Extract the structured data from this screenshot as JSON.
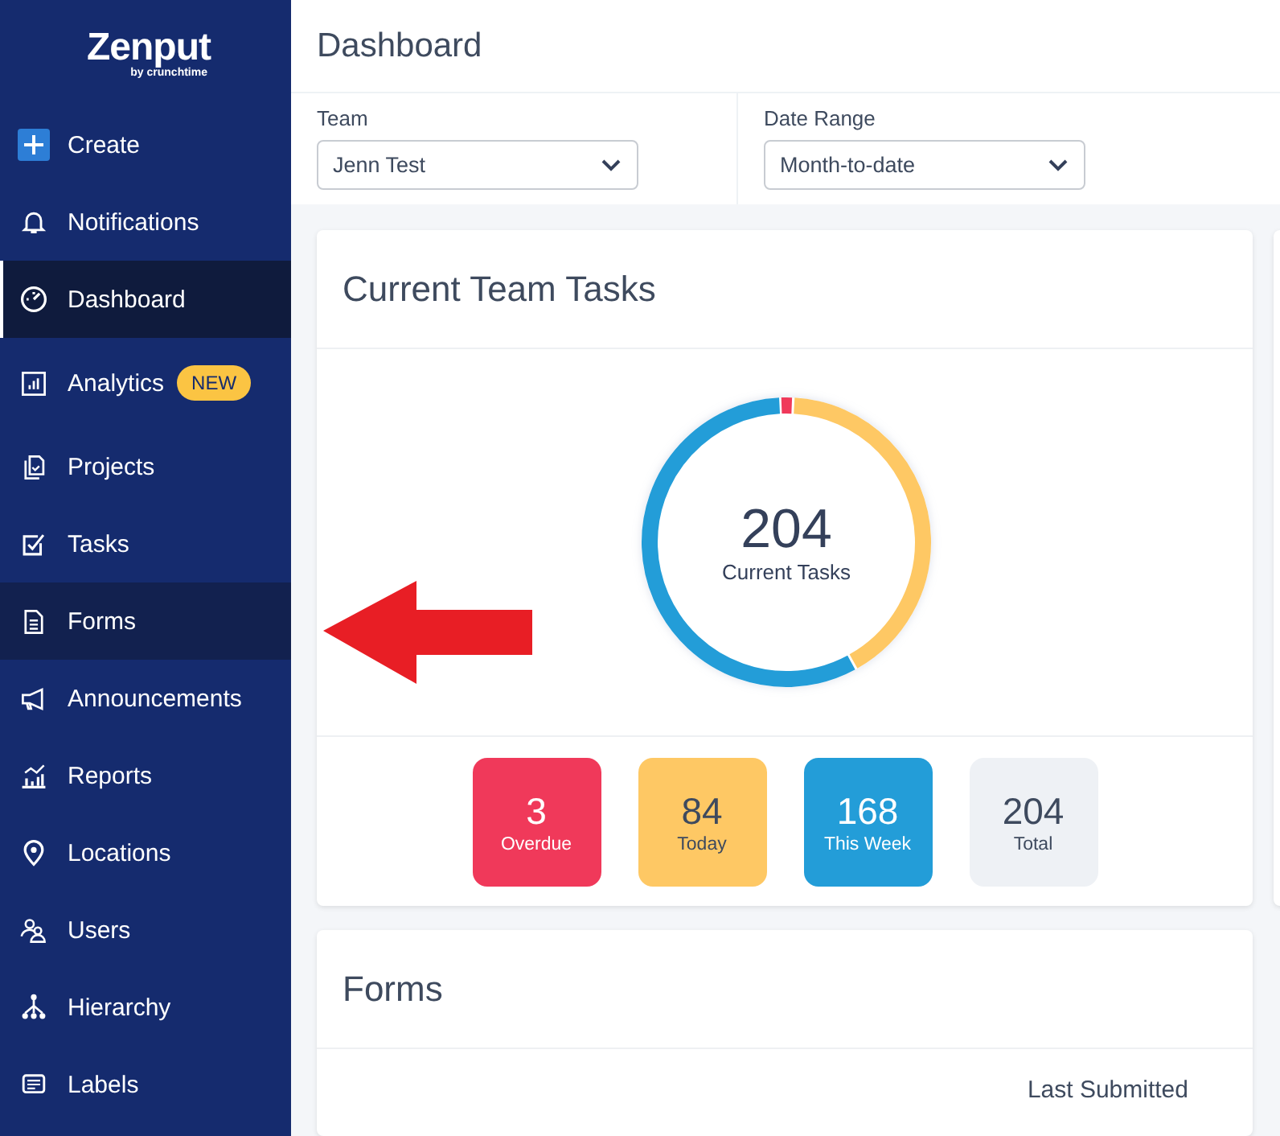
{
  "logo": {
    "name": "Zenput",
    "tagline": "by crunchtime"
  },
  "sidebar": {
    "items": [
      {
        "label": "Create",
        "kind": "create",
        "selected": false,
        "hovered": false
      },
      {
        "label": "Notifications",
        "kind": "bell",
        "selected": false,
        "hovered": false
      },
      {
        "label": "Dashboard",
        "kind": "gauge",
        "selected": true,
        "hovered": false
      },
      {
        "label": "Analytics",
        "kind": "analytics",
        "selected": false,
        "hovered": false,
        "badge": "NEW"
      },
      {
        "label": "Projects",
        "kind": "projects",
        "selected": false,
        "hovered": false
      },
      {
        "label": "Tasks",
        "kind": "tasks",
        "selected": false,
        "hovered": false
      },
      {
        "label": "Forms",
        "kind": "forms",
        "selected": false,
        "hovered": true
      },
      {
        "label": "Announcements",
        "kind": "megaphone",
        "selected": false,
        "hovered": false
      },
      {
        "label": "Reports",
        "kind": "reports",
        "selected": false,
        "hovered": false
      },
      {
        "label": "Locations",
        "kind": "pin",
        "selected": false,
        "hovered": false
      },
      {
        "label": "Users",
        "kind": "users",
        "selected": false,
        "hovered": false
      },
      {
        "label": "Hierarchy",
        "kind": "hierarchy",
        "selected": false,
        "hovered": false
      },
      {
        "label": "Labels",
        "kind": "labels",
        "selected": false,
        "hovered": false
      }
    ]
  },
  "page_title": "Dashboard",
  "filters": [
    {
      "label": "Team",
      "value": "Jenn Test"
    },
    {
      "label": "Date Range",
      "value": "Month-to-date"
    }
  ],
  "tasks_card": {
    "title": "Current Team Tasks",
    "center_value": "204",
    "center_label": "Current Tasks",
    "tiles": [
      {
        "kind": "overdue",
        "value": "3",
        "label": "Overdue"
      },
      {
        "kind": "today",
        "value": "84",
        "label": "Today"
      },
      {
        "kind": "week",
        "value": "168",
        "label": "This Week"
      },
      {
        "kind": "total",
        "value": "204",
        "label": "Total"
      }
    ]
  },
  "forms_card": {
    "title": "Forms",
    "column": "Last Submitted"
  }
}
